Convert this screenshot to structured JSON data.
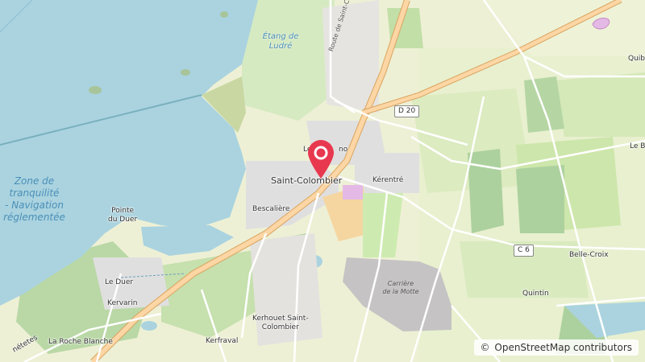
{
  "map": {
    "water_label": [
      "Zone de",
      "tranquilité",
      "- Navigation",
      "réglementée"
    ],
    "pond_label": [
      "Étang de",
      "Ludré"
    ],
    "quarry_label": [
      "Carrière",
      "de la Motte"
    ],
    "places": {
      "saint_colombier": "Saint-Colombier",
      "le_bourg_partial": "Le",
      "le_bourg_partial2": "no",
      "kerentre": "Kérentré",
      "bescaliere": "Bescalière",
      "pointe_du_duer_1": "Pointe",
      "pointe_du_duer_2": "du Duer",
      "le_duer": "Le Duer",
      "kervarin": "Kervarin",
      "kerhouet_1": "Kerhouet Saint-",
      "kerhouet_2": "Colombier",
      "kerfraval": "Kerfraval",
      "la_roche_blanche": "La Roche Blanche",
      "belle_croix": "Belle-Croix",
      "quintin": "Quintin",
      "quib_partial": "Quib",
      "le_b_partial": "Le B",
      "netetes_partial": "nétetes"
    },
    "roads": {
      "route_de_saint": "Route de Saint-C",
      "d20": "D 20",
      "c6": "C 6"
    },
    "attribution": {
      "symbol": "©",
      "text": "OpenStreetMap contributors"
    },
    "colors": {
      "sea": "#aad3df",
      "land": "#f2efe9",
      "meadow": "#cdebb0",
      "forest": "#add19e",
      "farmland": "#eef0d5",
      "wetland": "#d6eac2",
      "road_main": "#fcd6a4",
      "pin": "#e8384f"
    }
  }
}
